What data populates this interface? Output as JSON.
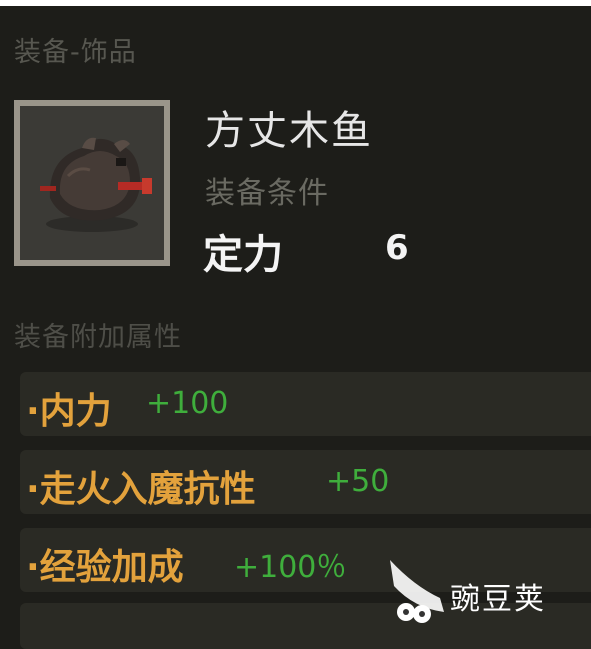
{
  "section": {
    "title": "装备-饰品"
  },
  "item": {
    "icon": "wooden-fish-icon",
    "name": "方丈木鱼",
    "requirement_label": "装备条件",
    "requirement_stat": "定力",
    "requirement_value": "6"
  },
  "attributes": {
    "title": "装备附加属性",
    "rows": [
      {
        "name": "·内力",
        "value": "+100"
      },
      {
        "name": "·走火入魔抗性",
        "value": "+50"
      },
      {
        "name": "·经验加成",
        "value": "+100％"
      }
    ]
  },
  "watermark": {
    "logo": "pea-pod-logo",
    "text": "豌豆荚"
  },
  "colors": {
    "background": "#1d1d19",
    "attribute_name": "#e3a23c",
    "attribute_value": "#3fae3c",
    "frame": "#9a958a"
  }
}
